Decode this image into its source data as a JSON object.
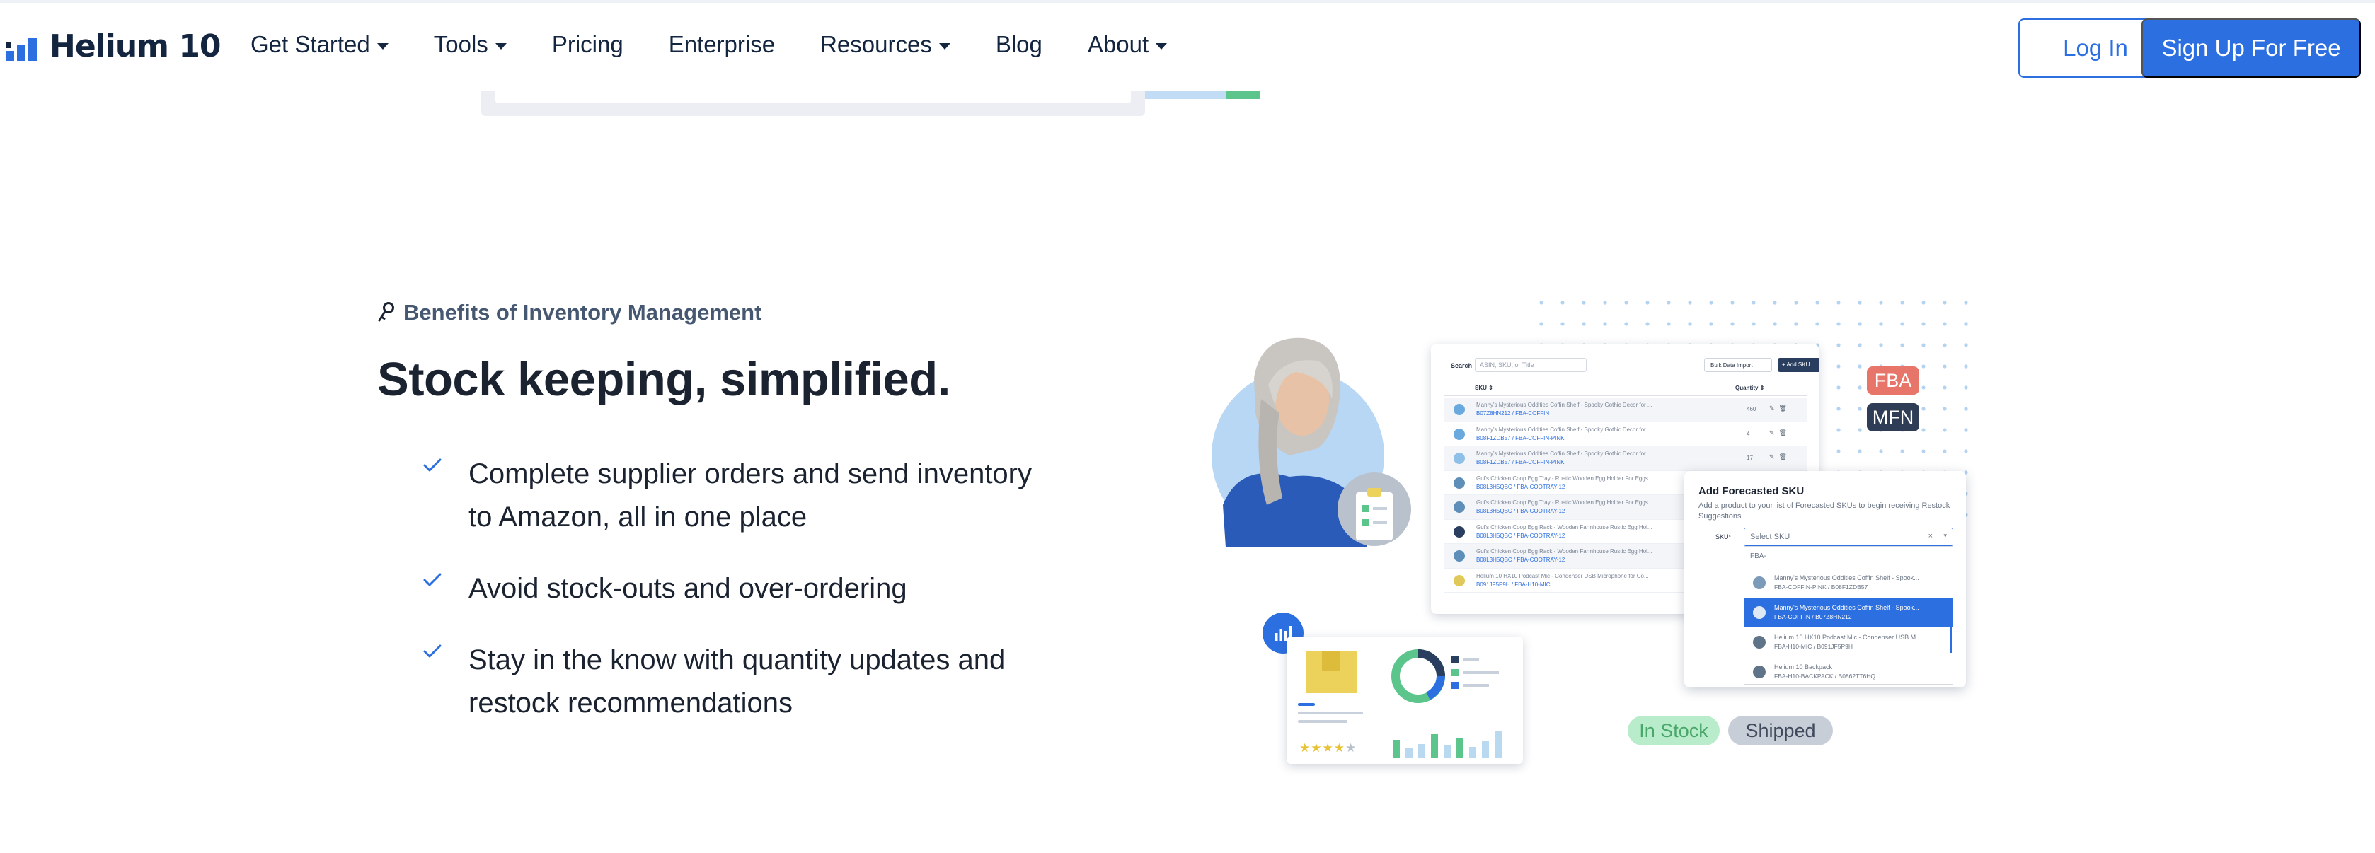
{
  "brand": {
    "name": "Helium 10",
    "primary_color": "#2c6fe0",
    "dark_color": "#13253f"
  },
  "nav": {
    "items": [
      {
        "label": "Get Started",
        "has_dropdown": true
      },
      {
        "label": "Tools",
        "has_dropdown": true
      },
      {
        "label": "Pricing",
        "has_dropdown": false
      },
      {
        "label": "Enterprise",
        "has_dropdown": false
      },
      {
        "label": "Resources",
        "has_dropdown": true
      },
      {
        "label": "Blog",
        "has_dropdown": false
      },
      {
        "label": "About",
        "has_dropdown": true
      }
    ],
    "login_label": "Log In",
    "signup_label": "Sign Up For Free"
  },
  "section": {
    "eyebrow_icon": "key-icon",
    "eyebrow": "Benefits of Inventory Management",
    "headline": "Stock keeping, simplified.",
    "check_icon": "checkmark-icon",
    "bullets": [
      "Complete supplier orders and send inventory to Amazon, all in one place",
      "Avoid stock-outs and over-ordering",
      "Stay in the know with quantity updates and restock recommendations"
    ]
  },
  "illustration": {
    "table": {
      "search_label": "Search",
      "search_placeholder": "ASIN, SKU, or Title",
      "bulk_label": "Bulk Data Import",
      "add_label": "+ Add SKU",
      "col_sku": "SKU ⇕",
      "col_qty": "Quantity ⇕",
      "rows": [
        {
          "title": "Manny's Mysterious Oddities Coffin Shelf - Spooky Gothic Decor for ...",
          "sku": "B07Z8HN212 / FBA-COFFIN",
          "qty": "460"
        },
        {
          "title": "Manny's Mysterious Oddities Coffin Shelf - Spooky Gothic Decor for ...",
          "sku": "B08F1ZDB57 / FBA-COFFIN-PINK",
          "qty": "4"
        },
        {
          "title": "Manny's Mysterious Oddities Coffin Shelf - Spooky Gothic Decor for ...",
          "sku": "B08F1ZDB57 / FBA-COFFIN-PINK",
          "qty": "17"
        },
        {
          "title": "Gui's Chicken Coop Egg Tray - Rustic Wooden Egg Holder For Eggs ...",
          "sku": "B08L3H5QBC / FBA-COOTRAY-12",
          "qty": ""
        },
        {
          "title": "Gui's Chicken Coop Egg Tray - Rustic Wooden Egg Holder For Eggs ...",
          "sku": "B08L3H5QBC / FBA-COOTRAY-12",
          "qty": ""
        },
        {
          "title": "Gui's Chicken Coop Egg Rack - Wooden Farmhouse Rustic Egg Hol...",
          "sku": "B08L3H5QBC / FBA-COOTRAY-12",
          "qty": ""
        },
        {
          "title": "Gui's Chicken Coop Egg Rack - Wooden Farmhouse Rustic Egg Hol...",
          "sku": "B08L3H5QBC / FBA-COOTRAY-12",
          "qty": ""
        },
        {
          "title": "Helium 10 HX10 Podcast Mic - Condenser USB Microphone for Co...",
          "sku": "B091JF5P9H / FBA-H10-MIC",
          "qty": ""
        }
      ]
    },
    "badges": {
      "fba": "FBA",
      "mfn": "MFN",
      "fba_color": "#e8756a",
      "mfn_color": "#2e3d55"
    },
    "modal": {
      "title": "Add Forecasted SKU",
      "description": "Add a product to your list of Forecasted SKUs to begin receiving Restock Suggestions",
      "sku_label": "SKU*",
      "select_placeholder": "Select SKU",
      "clear_glyph": "×",
      "caret_glyph": "▾",
      "query": "FBA-",
      "options": [
        {
          "title": "Manny's Mysterious Oddities Coffin Shelf - Spook...",
          "sku": "FBA-COFFIN-PINK / B08F1ZDB57",
          "selected": false
        },
        {
          "title": "Manny's Mysterious Oddities Coffin Shelf - Spook...",
          "sku": "FBA-COFFIN / B07Z8HN212",
          "selected": true
        },
        {
          "title": "Helium 10 HX10 Podcast Mic - Condenser USB M...",
          "sku": "FBA-H10-MIC / B091JF5P9H",
          "selected": false
        },
        {
          "title": "Helium 10 Backpack",
          "sku": "FBA-H10-BACKPACK / B0862TT6HQ",
          "selected": false
        }
      ]
    },
    "dashboard": {
      "rating_stars": "★★★★",
      "rating_empty": "★"
    },
    "pills": {
      "in_stock": "In Stock",
      "shipped": "Shipped"
    }
  }
}
